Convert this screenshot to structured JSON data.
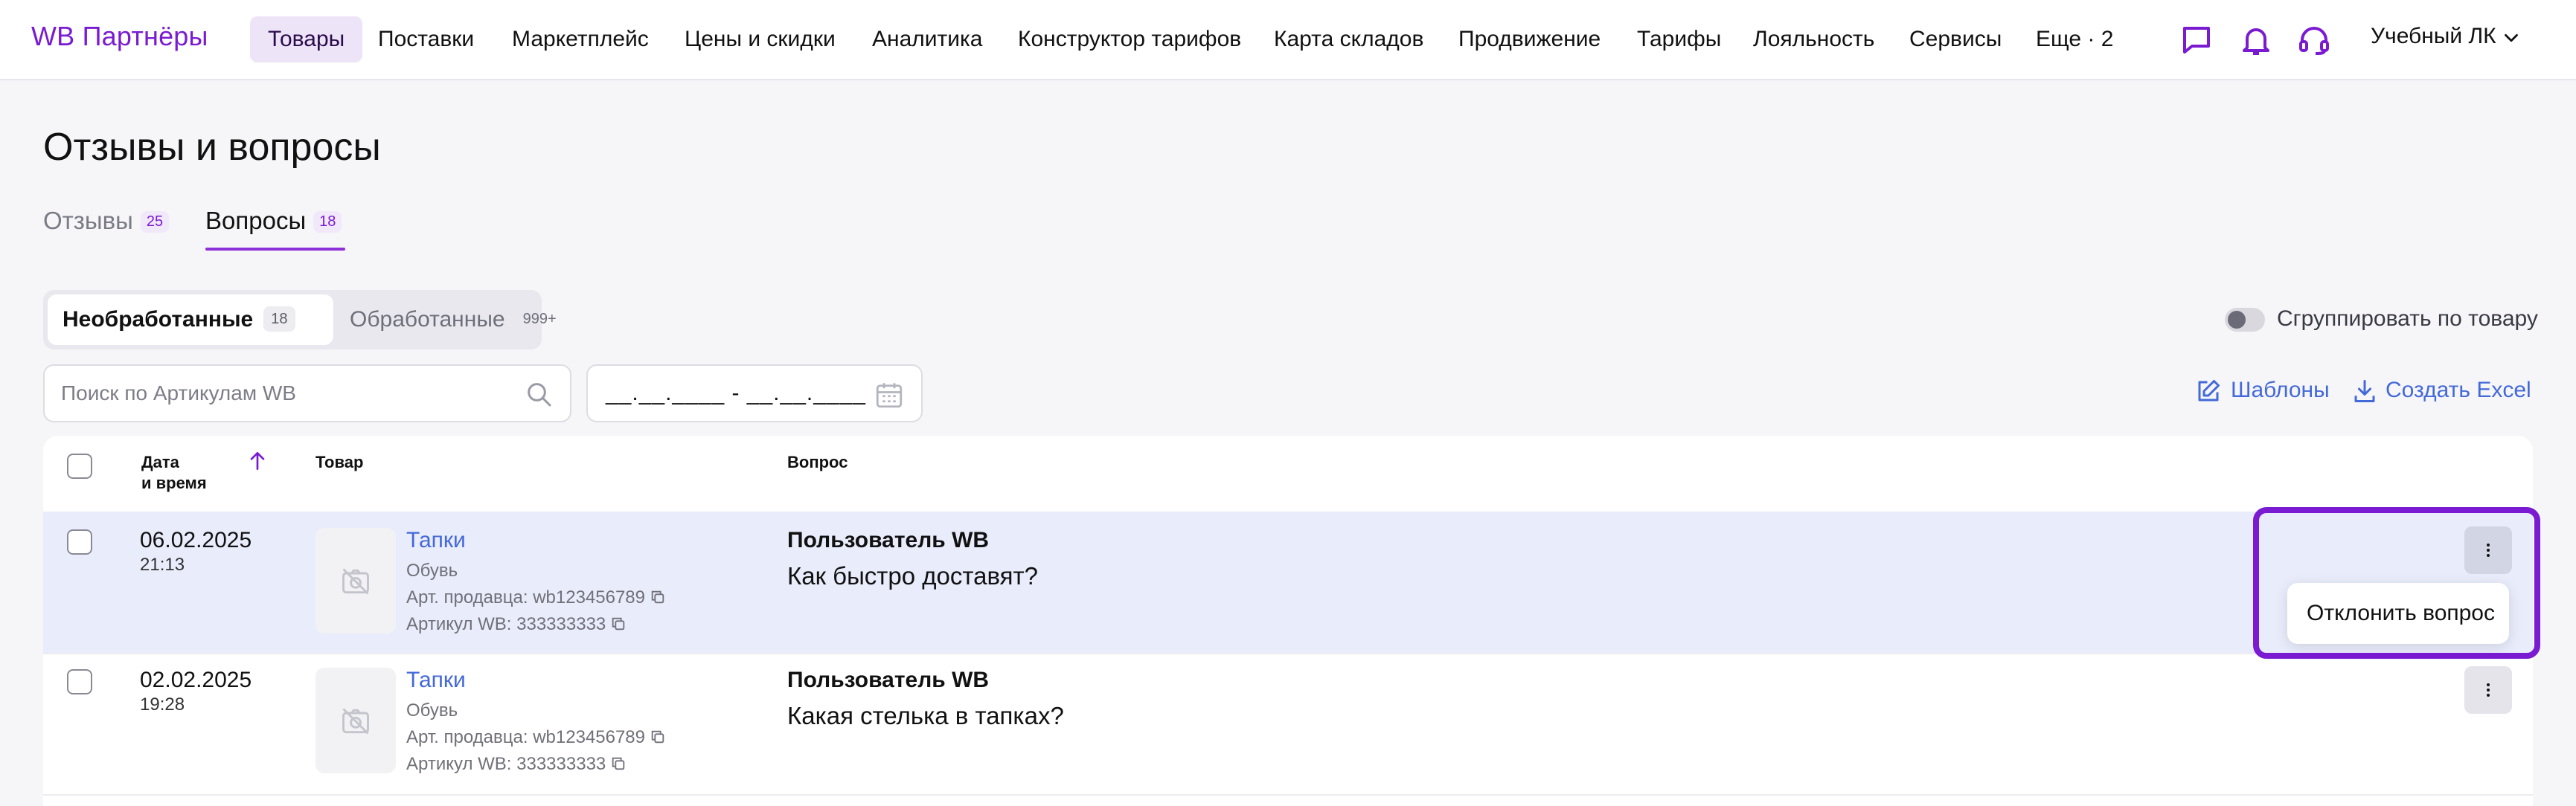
{
  "header": {
    "logo": "WB Партнёры",
    "nav": [
      {
        "label": "Товары",
        "active": true
      },
      {
        "label": "Поставки"
      },
      {
        "label": "Маркетплейс"
      },
      {
        "label": "Цены и скидки"
      },
      {
        "label": "Аналитика"
      },
      {
        "label": "Конструктор тарифов"
      },
      {
        "label": "Карта складов"
      },
      {
        "label": "Продвижение"
      },
      {
        "label": "Тарифы"
      },
      {
        "label": "Лояльность"
      },
      {
        "label": "Сервисы"
      },
      {
        "label": "Еще · 2"
      }
    ],
    "icons": [
      "chat-icon",
      "bell-icon",
      "headset-icon"
    ],
    "account": "Учебный ЛК"
  },
  "page": {
    "title": "Отзывы и вопросы",
    "tabs": [
      {
        "label": "Отзывы",
        "count": "25",
        "active": false
      },
      {
        "label": "Вопросы",
        "count": "18",
        "active": true
      }
    ]
  },
  "filters": {
    "segments": [
      {
        "label": "Необработанные",
        "count": "18",
        "active": true
      },
      {
        "label": "Обработанные",
        "count": "999+",
        "active": false
      }
    ],
    "group_toggle_label": "Сгруппировать по товару",
    "group_toggle_on": false,
    "search_placeholder": "Поиск по Артикулам WB",
    "date_placeholder": "__.__.____ - __.__.____",
    "templates_label": "Шаблоны",
    "excel_label": "Создать Excel"
  },
  "table": {
    "columns": {
      "date_line1": "Дата",
      "date_line2": "и время",
      "product": "Товар",
      "question": "Вопрос"
    },
    "rows": [
      {
        "date": "06.02.2025",
        "time": "21:13",
        "product_name": "Тапки",
        "category": "Обувь",
        "seller_article": "Арт. продавца: wb123456789",
        "wb_article": "Артикул WB: 333333333",
        "user": "Пользователь WB",
        "question": "Как быстро доставят?",
        "highlighted": true
      },
      {
        "date": "02.02.2025",
        "time": "19:28",
        "product_name": "Тапки",
        "category": "Обувь",
        "seller_article": "Арт. продавца: wb123456789",
        "wb_article": "Артикул WB: 333333333",
        "user": "Пользователь WB",
        "question": "Какая стелька в тапках?",
        "highlighted": false
      }
    ]
  },
  "row_menu": {
    "item": "Отклонить вопрос"
  },
  "colors": {
    "brand": "#7a1bd2",
    "link": "#4469d8",
    "row_highlight": "#e9ecfb",
    "background": "#f6f6f9"
  }
}
